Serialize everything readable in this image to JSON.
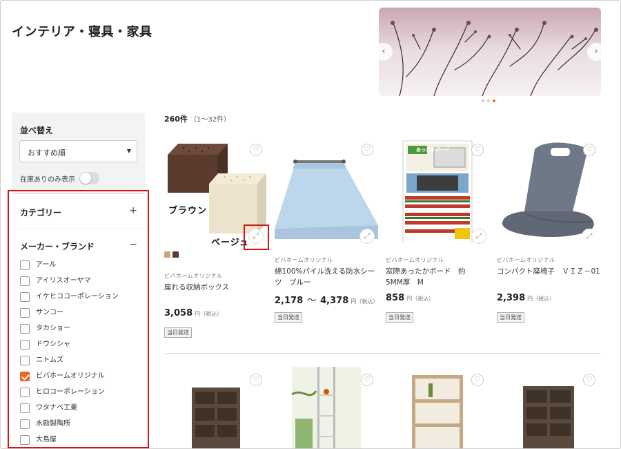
{
  "page": {
    "title": "インテリア・寝具・家具"
  },
  "banner": {
    "prev": "‹",
    "next": "›",
    "dots": 3,
    "active_dot": 2
  },
  "sidebar": {
    "sort_title": "並べ替え",
    "sort_value": "おすすめ順",
    "stock_only_label": "在庫ありのみ表示",
    "stock_only_on": false,
    "category": {
      "label": "カテゴリー",
      "sign": "+"
    },
    "brand": {
      "label": "メーカー・ブランド",
      "sign": "−",
      "items": [
        {
          "label": "アール",
          "checked": false
        },
        {
          "label": "アイリスオーヤマ",
          "checked": false
        },
        {
          "label": "イケヒココーポレーション",
          "checked": false
        },
        {
          "label": "サンコー",
          "checked": false
        },
        {
          "label": "タカショー",
          "checked": false
        },
        {
          "label": "ドウシシャ",
          "checked": false
        },
        {
          "label": "ニトムズ",
          "checked": false
        },
        {
          "label": "ビバホームオリジナル",
          "checked": true
        },
        {
          "label": "ヒロコーポレーション",
          "checked": false
        },
        {
          "label": "ワタナベ工業",
          "checked": false
        },
        {
          "label": "水勘製陶所",
          "checked": false
        },
        {
          "label": "大島屋",
          "checked": false
        }
      ]
    }
  },
  "results": {
    "count": "260件",
    "range": "（1～32件）",
    "products": [
      {
        "brand": "ビバホームオリジナル",
        "name": "座れる収納ボックス",
        "price": "3,058",
        "price_unit": "円（税込）",
        "ship": "当日発送",
        "labels": [
          "ブラウン",
          "ベージュ"
        ],
        "swatches": [
          "#c8a77a",
          "#5a3b2a"
        ]
      },
      {
        "brand": "ビバホームオリジナル",
        "name": "綿100%パイル洗える防水シーツ　ブルー",
        "price_from": "2,178",
        "tilde": "～",
        "price_to": "4,378",
        "price_unit": "円（税込）",
        "ship": "当日発送"
      },
      {
        "brand": "ビバホームオリジナル",
        "name": "窓際あったかボード　約　5MM厚　M",
        "price": "858",
        "price_unit": "円（税込）",
        "ship": "当日発送",
        "packaging_text": "あったかボード"
      },
      {
        "brand": "ビバホームオリジナル",
        "name": "コンパクト座椅子　ＶＩＺ－01",
        "price": "2,398",
        "price_unit": "円（税込）",
        "ship": "当日発送"
      }
    ]
  },
  "icons": {
    "heart": "heart-icon",
    "zoom": "expand-icon"
  },
  "colors": {
    "accent": "#f0641e",
    "highlight": "#d01616"
  }
}
